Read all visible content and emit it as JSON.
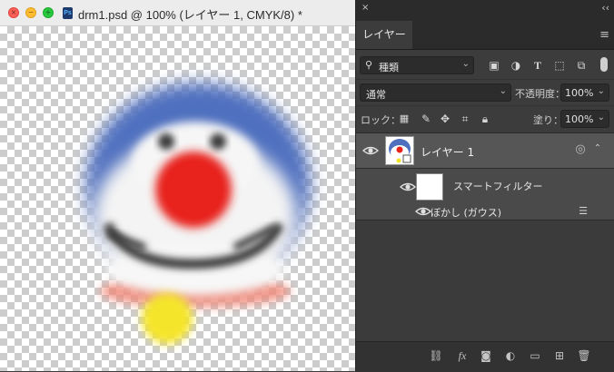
{
  "document": {
    "title": "drm1.psd @ 100% (レイヤー 1, CMYK/8) *",
    "app_icon": "Ps"
  },
  "panel": {
    "close_icon": "×",
    "collapse_icon": "‹‹",
    "tab_label": "レイヤー",
    "filter_kind": "種類",
    "blend_mode": "通常",
    "opacity_label": "不透明度：",
    "opacity_value": "100%",
    "lock_label": "ロック：",
    "fill_label": "塗り：",
    "fill_value": "100%",
    "layer_name": "レイヤー 1",
    "smart_filter_label": "スマートフィルター",
    "filter_item_label": "ぼかし (ガウス)"
  },
  "colors": {
    "panel_bg": "#3c3c3c",
    "selected_layer": "#565656",
    "face_blue": "#4f6fbf",
    "nose_red": "#e8231a",
    "bell_yellow": "#f5e52a"
  }
}
